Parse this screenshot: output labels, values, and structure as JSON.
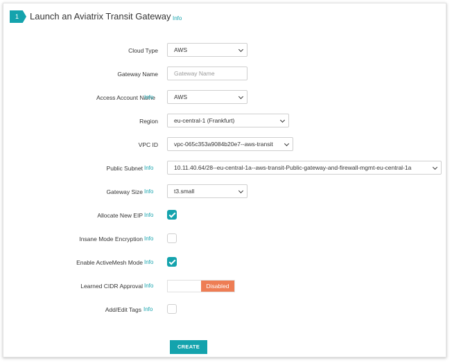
{
  "header": {
    "step_number": "1",
    "title": "Launch an Aviatrix Transit Gateway",
    "info_label": "Info"
  },
  "form": {
    "cloud_type": {
      "label": "Cloud Type",
      "value": "AWS"
    },
    "gateway_name": {
      "label": "Gateway Name",
      "placeholder": "Gateway Name"
    },
    "access_account": {
      "label": "Access Account Name",
      "info": "Info",
      "value": "AWS"
    },
    "region": {
      "label": "Region",
      "value": "eu-central-1 (Frankfurt)"
    },
    "vpc_id": {
      "label": "VPC ID",
      "value": "vpc-065c353a9084b20e7--aws-transit"
    },
    "public_subnet": {
      "label": "Public Subnet",
      "info": "Info",
      "value": "10.11.40.64/28--eu-central-1a--aws-transit-Public-gateway-and-firewall-mgmt-eu-central-1a"
    },
    "gateway_size": {
      "label": "Gateway Size",
      "info": "Info",
      "value": "t3.small"
    },
    "allocate_eip": {
      "label": "Allocate New EIP",
      "info": "Info",
      "checked": true
    },
    "insane_mode": {
      "label": "Insane Mode Encryption",
      "info": "Info",
      "checked": false
    },
    "activemesh": {
      "label": "Enable ActiveMesh Mode",
      "info": "Info",
      "checked": true
    },
    "learned_cidr": {
      "label": "Learned CIDR Approval",
      "info": "Info",
      "state": "Disabled"
    },
    "tags": {
      "label": "Add/Edit Tags",
      "info": "Info",
      "checked": false
    }
  },
  "actions": {
    "create_label": "CREATE"
  },
  "colors": {
    "accent": "#14a3ad",
    "disabled": "#ee7d54"
  }
}
